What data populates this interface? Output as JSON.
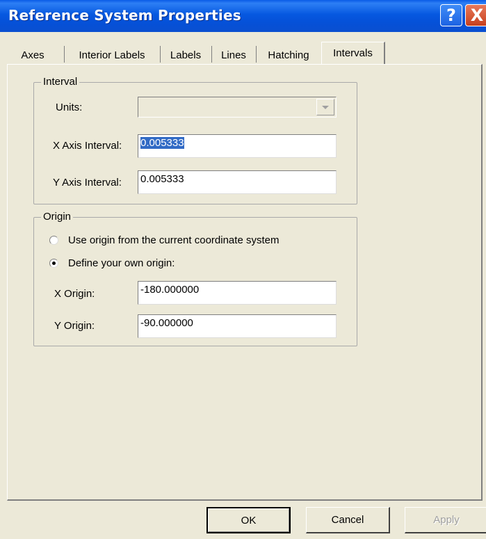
{
  "window": {
    "title": "Reference System Properties",
    "help_glyph": "?",
    "close_glyph": "X"
  },
  "tabs": [
    {
      "label": "Axes"
    },
    {
      "label": "Interior Labels"
    },
    {
      "label": "Labels"
    },
    {
      "label": "Lines"
    },
    {
      "label": "Hatching"
    },
    {
      "label": "Intervals",
      "active": true
    }
  ],
  "interval": {
    "title": "Interval",
    "units_label": "Units:",
    "units_value": "",
    "x_label": "X Axis Interval:",
    "x_value": "0.005333",
    "y_label": "Y Axis Interval:",
    "y_value": "0.005333"
  },
  "origin": {
    "title": "Origin",
    "option_current": "Use origin from the current coordinate system",
    "option_custom": "Define your own origin:",
    "selected": "custom",
    "x_label": "X Origin:",
    "x_value": "-180.000000",
    "y_label": "Y Origin:",
    "y_value": "-90.000000"
  },
  "buttons": {
    "ok": "OK",
    "cancel": "Cancel",
    "apply": "Apply"
  },
  "colors": {
    "titlebar": "#0658e0",
    "dialog_bg": "#ece9d8",
    "selection": "#316ac5"
  }
}
